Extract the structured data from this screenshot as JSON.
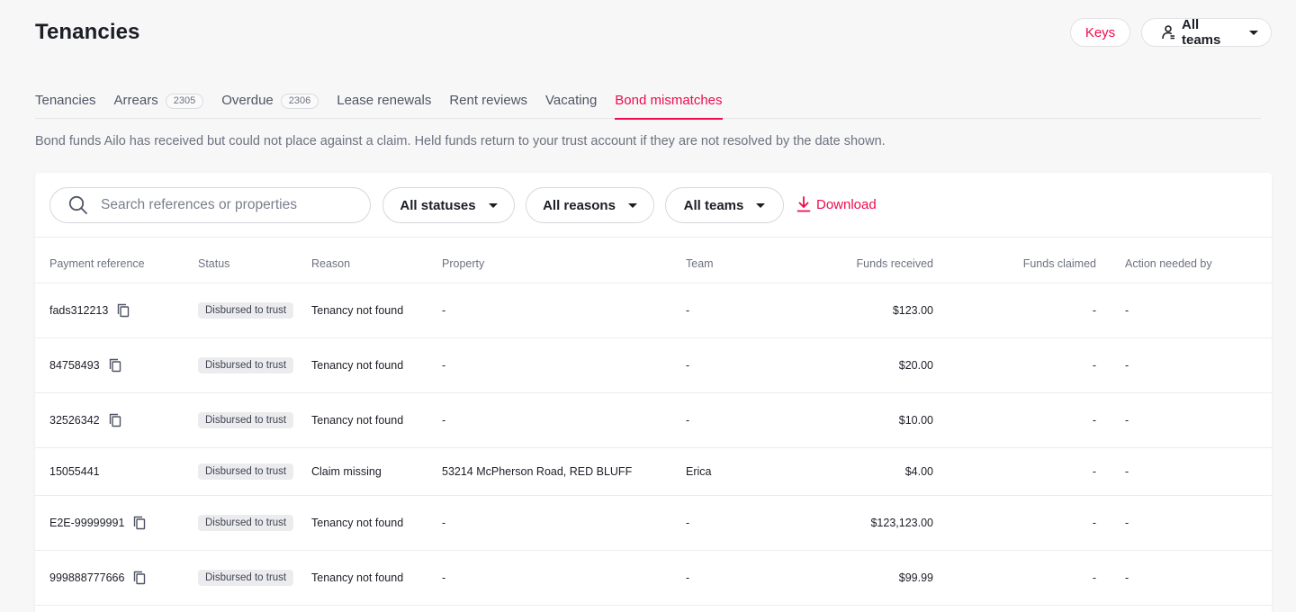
{
  "header": {
    "title": "Tenancies",
    "keys_label": "Keys",
    "teams_label": "All teams"
  },
  "tabs": [
    {
      "label": "Tenancies",
      "count": null
    },
    {
      "label": "Arrears",
      "count": "2305"
    },
    {
      "label": "Overdue",
      "count": "2306"
    },
    {
      "label": "Lease renewals",
      "count": null
    },
    {
      "label": "Rent reviews",
      "count": null
    },
    {
      "label": "Vacating",
      "count": null
    },
    {
      "label": "Bond mismatches",
      "count": null,
      "active": true
    }
  ],
  "description": "Bond funds Ailo has received but could not place against a claim. Held funds return to your trust account if they are not resolved by the date shown.",
  "toolbar": {
    "search_placeholder": "Search references or properties",
    "statuses_label": "All statuses",
    "reasons_label": "All reasons",
    "teams_label": "All teams",
    "download_label": "Download"
  },
  "table": {
    "columns": [
      "Payment reference",
      "Status",
      "Reason",
      "Property",
      "Team",
      "Funds received",
      "Funds claimed",
      "Action needed by"
    ],
    "rows": [
      {
        "ref": "fads312213",
        "copy": true,
        "status": "Disbursed to trust",
        "reason": "Tenancy not found",
        "property": "-",
        "team": "-",
        "received": "$123.00",
        "claimed": "-",
        "action": "-"
      },
      {
        "ref": "84758493",
        "copy": true,
        "status": "Disbursed to trust",
        "reason": "Tenancy not found",
        "property": "-",
        "team": "-",
        "received": "$20.00",
        "claimed": "-",
        "action": "-"
      },
      {
        "ref": "32526342",
        "copy": true,
        "status": "Disbursed to trust",
        "reason": "Tenancy not found",
        "property": "-",
        "team": "-",
        "received": "$10.00",
        "claimed": "-",
        "action": "-"
      },
      {
        "ref": "15055441",
        "copy": false,
        "status": "Disbursed to trust",
        "reason": "Claim missing",
        "property": "53214 McPherson Road, RED BLUFF",
        "team": "Erica",
        "received": "$4.00",
        "claimed": "-",
        "action": "-"
      },
      {
        "ref": "E2E-99999991",
        "copy": true,
        "status": "Disbursed to trust",
        "reason": "Tenancy not found",
        "property": "-",
        "team": "-",
        "received": "$123,123.00",
        "claimed": "-",
        "action": "-"
      },
      {
        "ref": "999888777666",
        "copy": true,
        "status": "Disbursed to trust",
        "reason": "Tenancy not found",
        "property": "-",
        "team": "-",
        "received": "$99.99",
        "claimed": "-",
        "action": "-"
      }
    ]
  },
  "colors": {
    "accent": "#ee0b4f",
    "text": "#1c1e26",
    "muted": "#6d7280",
    "background": "#f7f7f7"
  }
}
